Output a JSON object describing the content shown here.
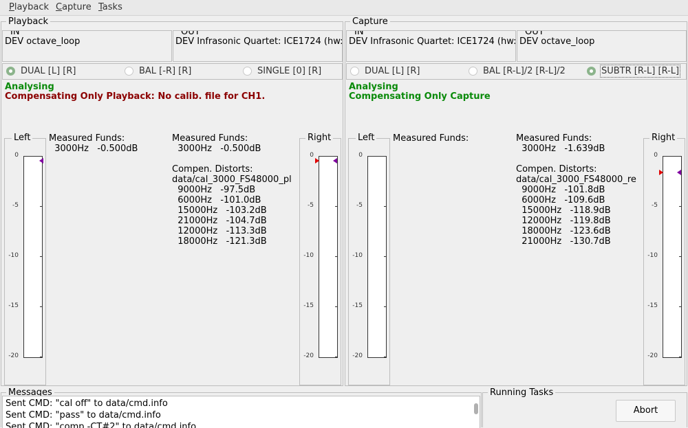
{
  "menu": {
    "items": [
      {
        "ul": "P",
        "rest": "layback"
      },
      {
        "ul": "C",
        "rest": "apture"
      },
      {
        "ul": "T",
        "rest": "asks"
      }
    ]
  },
  "playback": {
    "title": "Playback",
    "in_label": "IN",
    "in_value": "DEV octave_loop",
    "out_label": "OUT",
    "out_value": "DEV Infrasonic Quartet: ICE1724 (hw:",
    "radios": [
      {
        "label": "DUAL [L] [R]",
        "checked": true
      },
      {
        "label": "BAL [-R] [R]",
        "checked": false
      },
      {
        "label": "SINGLE [0] [R]",
        "checked": false
      }
    ],
    "status1": "Analysing",
    "status2": "Compensating Only Playback:  No calib. file for CH1.",
    "left_title": "Left",
    "right_title": "Right",
    "left_funds_title": "Measured Funds:",
    "left_funds": [
      "  3000Hz   -0.500dB"
    ],
    "right_funds_title": "Measured Funds:",
    "right_funds": [
      "  3000Hz   -0.500dB"
    ],
    "distorts_title": "Compen. Distorts:",
    "distorts_file": "data/cal_3000_FS48000_pl",
    "distorts": [
      "  9000Hz   -97.5dB",
      "  6000Hz   -101.0dB",
      "  15000Hz   -103.2dB",
      "  21000Hz   -104.7dB",
      "  12000Hz   -113.3dB",
      "  18000Hz   -121.3dB"
    ]
  },
  "capture": {
    "title": "Capture",
    "in_label": "IN",
    "in_value": "DEV Infrasonic Quartet: ICE1724 (hw:",
    "out_label": "OUT",
    "out_value": "DEV octave_loop",
    "radios": [
      {
        "label": "DUAL [L] [R]",
        "checked": false
      },
      {
        "label": "BAL [R-L]/2 [R-L]/2",
        "checked": false
      },
      {
        "label": "SUBTR [R-L] [R-L]",
        "checked": true
      }
    ],
    "status1": "Analysing",
    "status2": "Compensating Only Capture",
    "left_title": "Left",
    "right_title": "Right",
    "left_funds_title": "Measured Funds:",
    "right_funds_title": "Measured Funds:",
    "right_funds": [
      "  3000Hz   -1.639dB"
    ],
    "distorts_title": "Compen. Distorts:",
    "distorts_file": "data/cal_3000_FS48000_re",
    "distorts": [
      "  9000Hz   -101.8dB",
      "  6000Hz   -109.6dB",
      "  15000Hz   -118.9dB",
      "  12000Hz   -119.8dB",
      "  18000Hz   -123.6dB",
      "  21000Hz   -130.7dB"
    ]
  },
  "meter": {
    "ticks": [
      "0",
      "-5",
      "-10",
      "-15",
      "-20"
    ],
    "min_db": -20,
    "max_db": 0
  },
  "levels": {
    "playback_left_db": -0.5,
    "playback_right_db": -0.5,
    "capture_right_db": -1.639
  },
  "colors": {
    "marker_red": "#e00000",
    "marker_purple": "#8000a0",
    "status_green": "#0a8a0a",
    "status_red": "#8b0000"
  },
  "messages": {
    "title": "Messages",
    "lines": [
      "Sent CMD: \"cal off\" to data/cmd.info",
      "Sent CMD: \"pass\" to data/cmd.info",
      "Sent CMD: \"comp -CT#2\" to data/cmd.info"
    ]
  },
  "tasks": {
    "title": "Running Tasks",
    "abort_label": "Abort"
  }
}
